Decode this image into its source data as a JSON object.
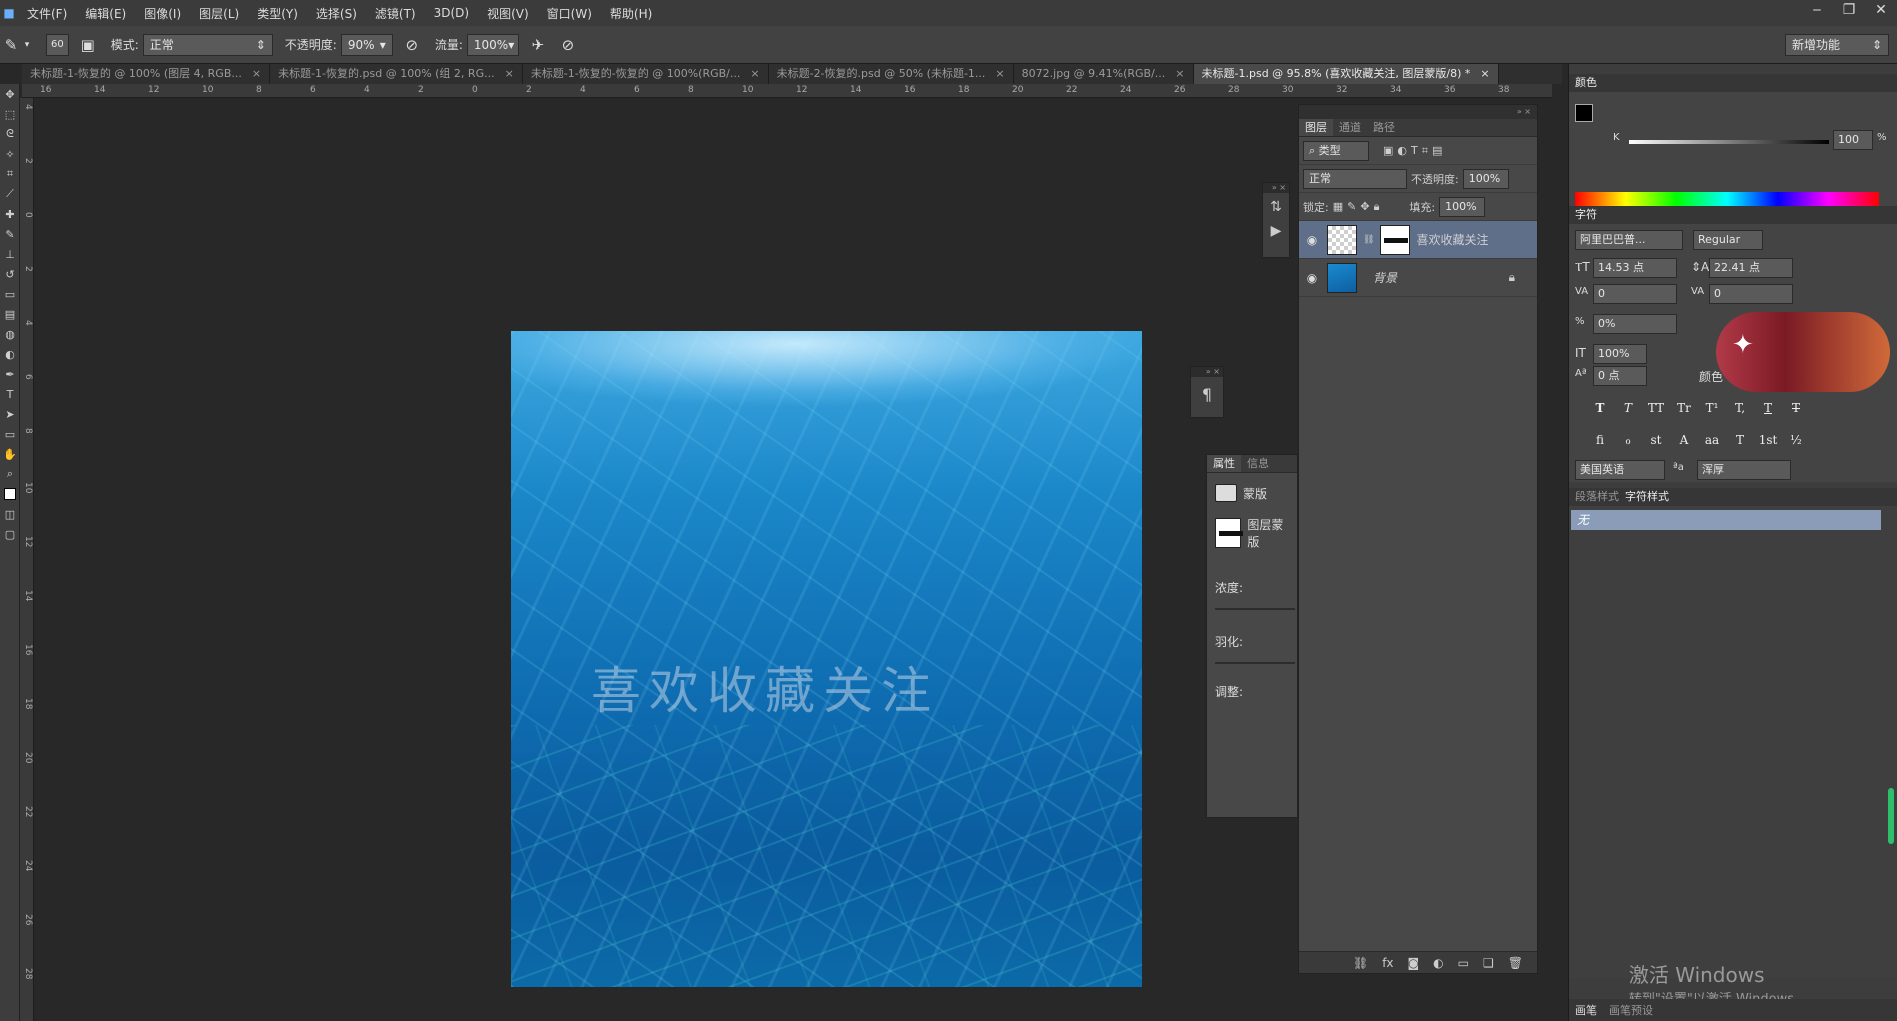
{
  "menu": [
    "文件(F)",
    "编辑(E)",
    "图像(I)",
    "图层(L)",
    "类型(Y)",
    "选择(S)",
    "滤镜(T)",
    "3D(D)",
    "视图(V)",
    "窗口(W)",
    "帮助(H)"
  ],
  "options": {
    "brush_size": "60",
    "mode_label": "模式:",
    "mode_value": "正常",
    "opacity_label": "不透明度:",
    "opacity_value": "90%",
    "flow_label": "流量:",
    "flow_value": "100%",
    "workspace": "新增功能"
  },
  "tabs": [
    "未标题-1-恢复的 @ 100% (图层 4, RGB...",
    "未标题-1-恢复的.psd @ 100% (组 2, RG...",
    "未标题-1-恢复的-恢复的 @ 100%(RGB/...",
    "未标题-2-恢复的.psd @ 50% (未标题-1...",
    "8072.jpg @ 9.41%(RGB/...",
    "未标题-1.psd @ 95.8% (喜欢收藏关注, 图层蒙版/8) *"
  ],
  "ruler_h": [
    "16",
    "14",
    "12",
    "10",
    "8",
    "6",
    "4",
    "2",
    "0",
    "2",
    "4",
    "6",
    "8",
    "10",
    "12",
    "14",
    "16",
    "18",
    "20",
    "22",
    "24",
    "26",
    "28",
    "30",
    "32",
    "34",
    "36",
    "38"
  ],
  "ruler_v": [
    "4",
    "2",
    "0",
    "2",
    "4",
    "6",
    "8",
    "10",
    "12",
    "14",
    "16",
    "18",
    "20",
    "22",
    "24",
    "26",
    "28"
  ],
  "document": {
    "watermark": "喜欢收藏关注"
  },
  "layers_panel": {
    "tabs": [
      "图层",
      "通道",
      "路径"
    ],
    "filter": "类型",
    "blend": "正常",
    "opacity_label": "不透明度:",
    "opacity_value": "100%",
    "lock_label": "锁定:",
    "fill_label": "填充:",
    "fill_value": "100%",
    "layers": [
      {
        "name": "喜欢收藏关注"
      },
      {
        "name": "背景"
      }
    ]
  },
  "properties": {
    "tabs": [
      "属性",
      "信息"
    ],
    "mask_title": "蒙版",
    "layer_mask": "图层蒙版",
    "density": "浓度:",
    "feather": "羽化:",
    "adjust": "调整:"
  },
  "color_panel": {
    "title": "颜色",
    "channel": "K",
    "value": "100",
    "unit": "%"
  },
  "character_panel": {
    "title": "字符",
    "font_family": "阿里巴巴普...",
    "font_style": "Regular",
    "size": "14.53 点",
    "leading": "22.41 点",
    "kerning": "0",
    "tracking": "0",
    "tsume": "0%",
    "vscale": "100%",
    "baseline": "0 点",
    "color_label": "颜色",
    "language": "美国英语",
    "aa_label": "ªa",
    "aa_value": "浑厚",
    "type_buttons": [
      "T",
      "T",
      "TT",
      "Tr",
      "T¹",
      "T,",
      "T",
      "T"
    ],
    "ot_buttons": [
      "ﬁ",
      "ℴ",
      "st",
      "A",
      "aa",
      "T",
      "1st",
      "½"
    ]
  },
  "para_styles": {
    "tabs": [
      "段落样式",
      "字符样式"
    ],
    "item": "无"
  },
  "bottom_tabs": [
    "画笔",
    "画笔预设"
  ],
  "activation": {
    "line1": "激活 Windows",
    "line2": "转到\"设置\"以激活 Windows。"
  },
  "colors": {
    "accent": "#5f6f8a",
    "bg": "#282828"
  }
}
